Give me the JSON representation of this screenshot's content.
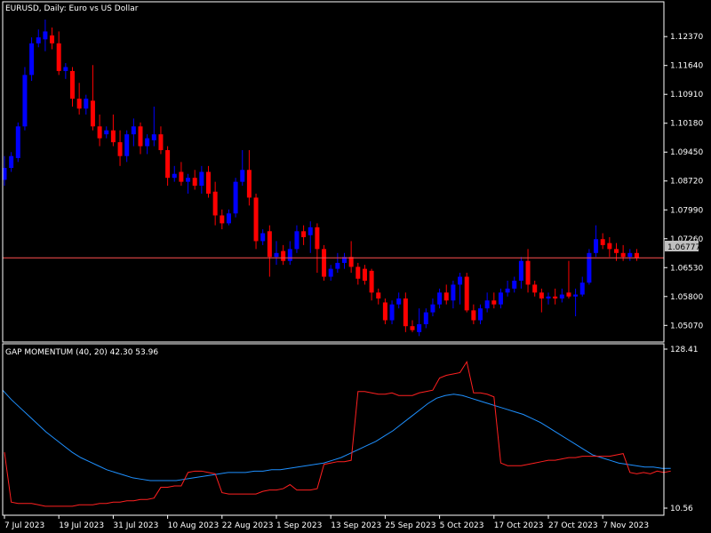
{
  "title": "EURUSD, Daily:  Euro vs US Dollar",
  "price_label": "1.06777",
  "indicator_title": "GAP MOMENTUM (40, 20) 42.30 53.96",
  "colors": {
    "background": "#000000",
    "frame": "#ffffff",
    "bull": "#0000ff",
    "bear": "#ff0000",
    "price_line": "#ff5050",
    "price_label_bg": "#c0c0c0",
    "gap_line": "#ff2020",
    "signal_line": "#1e90ff"
  },
  "chart_data": [
    {
      "type": "candlestick",
      "symbol": "EURUSD",
      "timeframe": "Daily",
      "y_ticks": [
        "1.12370",
        "1.11640",
        "1.10910",
        "1.10180",
        "1.09450",
        "1.08720",
        "1.07990",
        "1.07260",
        "1.06530",
        "1.05800",
        "1.05070"
      ],
      "ylim": [
        1.0465,
        1.1325
      ],
      "current_price": 1.06777,
      "x_labels": [
        "7 Jul 2023",
        "19 Jul 2023",
        "31 Jul 2023",
        "10 Aug 2023",
        "22 Aug 2023",
        "1 Sep 2023",
        "13 Sep 2023",
        "25 Sep 2023",
        "5 Oct 2023",
        "17 Oct 2023",
        "27 Oct 2023",
        "7 Nov 2023"
      ],
      "x_label_index": [
        0,
        8,
        16,
        24,
        32,
        40,
        48,
        56,
        64,
        72,
        80,
        88
      ],
      "candles": [
        {
          "o": 1.0875,
          "h": 1.0935,
          "l": 1.086,
          "c": 1.0905
        },
        {
          "o": 1.0905,
          "h": 1.0945,
          "l": 1.0895,
          "c": 1.0935
        },
        {
          "o": 1.093,
          "h": 1.102,
          "l": 1.092,
          "c": 1.101
        },
        {
          "o": 1.101,
          "h": 1.116,
          "l": 1.1,
          "c": 1.114
        },
        {
          "o": 1.114,
          "h": 1.1235,
          "l": 1.1125,
          "c": 1.122
        },
        {
          "o": 1.122,
          "h": 1.1255,
          "l": 1.121,
          "c": 1.1235
        },
        {
          "o": 1.123,
          "h": 1.128,
          "l": 1.12,
          "c": 1.125
        },
        {
          "o": 1.124,
          "h": 1.126,
          "l": 1.1205,
          "c": 1.122
        },
        {
          "o": 1.122,
          "h": 1.125,
          "l": 1.114,
          "c": 1.115
        },
        {
          "o": 1.115,
          "h": 1.117,
          "l": 1.113,
          "c": 1.116
        },
        {
          "o": 1.115,
          "h": 1.116,
          "l": 1.106,
          "c": 1.108
        },
        {
          "o": 1.108,
          "h": 1.112,
          "l": 1.104,
          "c": 1.1055
        },
        {
          "o": 1.1055,
          "h": 1.109,
          "l": 1.104,
          "c": 1.108
        },
        {
          "o": 1.1075,
          "h": 1.1165,
          "l": 1.1,
          "c": 1.101
        },
        {
          "o": 1.101,
          "h": 1.104,
          "l": 1.096,
          "c": 1.098
        },
        {
          "o": 1.099,
          "h": 1.101,
          "l": 1.098,
          "c": 1.1
        },
        {
          "o": 1.1,
          "h": 1.104,
          "l": 1.096,
          "c": 1.097
        },
        {
          "o": 1.097,
          "h": 1.1,
          "l": 1.091,
          "c": 1.0935
        },
        {
          "o": 1.0935,
          "h": 1.1,
          "l": 1.092,
          "c": 1.099
        },
        {
          "o": 1.099,
          "h": 1.103,
          "l": 1.096,
          "c": 1.101
        },
        {
          "o": 1.101,
          "h": 1.102,
          "l": 1.094,
          "c": 1.096
        },
        {
          "o": 1.096,
          "h": 1.099,
          "l": 1.094,
          "c": 1.098
        },
        {
          "o": 1.0975,
          "h": 1.106,
          "l": 1.096,
          "c": 1.099
        },
        {
          "o": 1.099,
          "h": 1.101,
          "l": 1.094,
          "c": 1.095
        },
        {
          "o": 1.095,
          "h": 1.096,
          "l": 1.086,
          "c": 1.088
        },
        {
          "o": 1.088,
          "h": 1.091,
          "l": 1.087,
          "c": 1.089
        },
        {
          "o": 1.0895,
          "h": 1.092,
          "l": 1.086,
          "c": 1.087
        },
        {
          "o": 1.087,
          "h": 1.089,
          "l": 1.084,
          "c": 1.088
        },
        {
          "o": 1.088,
          "h": 1.09,
          "l": 1.085,
          "c": 1.086
        },
        {
          "o": 1.086,
          "h": 1.091,
          "l": 1.084,
          "c": 1.0895
        },
        {
          "o": 1.0895,
          "h": 1.091,
          "l": 1.083,
          "c": 1.084
        },
        {
          "o": 1.0845,
          "h": 1.087,
          "l": 1.076,
          "c": 1.0785
        },
        {
          "o": 1.0785,
          "h": 1.08,
          "l": 1.075,
          "c": 1.0765
        },
        {
          "o": 1.0765,
          "h": 1.08,
          "l": 1.076,
          "c": 1.079
        },
        {
          "o": 1.079,
          "h": 1.088,
          "l": 1.078,
          "c": 1.087
        },
        {
          "o": 1.087,
          "h": 1.095,
          "l": 1.086,
          "c": 1.09
        },
        {
          "o": 1.09,
          "h": 1.095,
          "l": 1.081,
          "c": 1.083
        },
        {
          "o": 1.083,
          "h": 1.084,
          "l": 1.07,
          "c": 1.072
        },
        {
          "o": 1.072,
          "h": 1.075,
          "l": 1.071,
          "c": 1.074
        },
        {
          "o": 1.0745,
          "h": 1.076,
          "l": 1.063,
          "c": 1.068
        },
        {
          "o": 1.068,
          "h": 1.072,
          "l": 1.066,
          "c": 1.069
        },
        {
          "o": 1.0695,
          "h": 1.071,
          "l": 1.066,
          "c": 1.067
        },
        {
          "o": 1.067,
          "h": 1.072,
          "l": 1.066,
          "c": 1.07
        },
        {
          "o": 1.07,
          "h": 1.076,
          "l": 1.069,
          "c": 1.0745
        },
        {
          "o": 1.0745,
          "h": 1.076,
          "l": 1.071,
          "c": 1.073
        },
        {
          "o": 1.0735,
          "h": 1.077,
          "l": 1.069,
          "c": 1.0755
        },
        {
          "o": 1.0755,
          "h": 1.0765,
          "l": 1.064,
          "c": 1.07
        },
        {
          "o": 1.07,
          "h": 1.071,
          "l": 1.062,
          "c": 1.063
        },
        {
          "o": 1.063,
          "h": 1.066,
          "l": 1.062,
          "c": 1.065
        },
        {
          "o": 1.065,
          "h": 1.069,
          "l": 1.064,
          "c": 1.0665
        },
        {
          "o": 1.0665,
          "h": 1.069,
          "l": 1.065,
          "c": 1.068
        },
        {
          "o": 1.068,
          "h": 1.072,
          "l": 1.064,
          "c": 1.0655
        },
        {
          "o": 1.0655,
          "h": 1.0665,
          "l": 1.061,
          "c": 1.0625
        },
        {
          "o": 1.065,
          "h": 1.066,
          "l": 1.061,
          "c": 1.062
        },
        {
          "o": 1.0645,
          "h": 1.065,
          "l": 1.057,
          "c": 1.059
        },
        {
          "o": 1.059,
          "h": 1.06,
          "l": 1.056,
          "c": 1.0575
        },
        {
          "o": 1.0565,
          "h": 1.0575,
          "l": 1.051,
          "c": 1.052
        },
        {
          "o": 1.052,
          "h": 1.057,
          "l": 1.051,
          "c": 1.056
        },
        {
          "o": 1.056,
          "h": 1.059,
          "l": 1.055,
          "c": 1.0575
        },
        {
          "o": 1.0575,
          "h": 1.059,
          "l": 1.049,
          "c": 1.0505
        },
        {
          "o": 1.0505,
          "h": 1.052,
          "l": 1.049,
          "c": 1.0495
        },
        {
          "o": 1.049,
          "h": 1.055,
          "l": 1.048,
          "c": 1.051
        },
        {
          "o": 1.051,
          "h": 1.055,
          "l": 1.05,
          "c": 1.054
        },
        {
          "o": 1.054,
          "h": 1.0575,
          "l": 1.053,
          "c": 1.056
        },
        {
          "o": 1.056,
          "h": 1.06,
          "l": 1.055,
          "c": 1.059
        },
        {
          "o": 1.059,
          "h": 1.061,
          "l": 1.056,
          "c": 1.057
        },
        {
          "o": 1.057,
          "h": 1.062,
          "l": 1.055,
          "c": 1.061
        },
        {
          "o": 1.061,
          "h": 1.064,
          "l": 1.056,
          "c": 1.063
        },
        {
          "o": 1.063,
          "h": 1.064,
          "l": 1.054,
          "c": 1.0545
        },
        {
          "o": 1.0545,
          "h": 1.056,
          "l": 1.051,
          "c": 1.052
        },
        {
          "o": 1.052,
          "h": 1.056,
          "l": 1.051,
          "c": 1.055
        },
        {
          "o": 1.055,
          "h": 1.059,
          "l": 1.054,
          "c": 1.057
        },
        {
          "o": 1.057,
          "h": 1.059,
          "l": 1.055,
          "c": 1.056
        },
        {
          "o": 1.056,
          "h": 1.06,
          "l": 1.055,
          "c": 1.059
        },
        {
          "o": 1.059,
          "h": 1.062,
          "l": 1.058,
          "c": 1.06
        },
        {
          "o": 1.06,
          "h": 1.063,
          "l": 1.059,
          "c": 1.062
        },
        {
          "o": 1.062,
          "h": 1.068,
          "l": 1.06,
          "c": 1.067
        },
        {
          "o": 1.067,
          "h": 1.07,
          "l": 1.059,
          "c": 1.061
        },
        {
          "o": 1.061,
          "h": 1.062,
          "l": 1.058,
          "c": 1.059
        },
        {
          "o": 1.059,
          "h": 1.06,
          "l": 1.054,
          "c": 1.0575
        },
        {
          "o": 1.0575,
          "h": 1.059,
          "l": 1.056,
          "c": 1.058
        },
        {
          "o": 1.058,
          "h": 1.06,
          "l": 1.056,
          "c": 1.0575
        },
        {
          "o": 1.0575,
          "h": 1.06,
          "l": 1.0565,
          "c": 1.0585
        },
        {
          "o": 1.059,
          "h": 1.067,
          "l": 1.0575,
          "c": 1.058
        },
        {
          "o": 1.058,
          "h": 1.06,
          "l": 1.053,
          "c": 1.0585
        },
        {
          "o": 1.0585,
          "h": 1.063,
          "l": 1.058,
          "c": 1.0615
        },
        {
          "o": 1.0615,
          "h": 1.07,
          "l": 1.061,
          "c": 1.069
        },
        {
          "o": 1.069,
          "h": 1.076,
          "l": 1.068,
          "c": 1.0725
        },
        {
          "o": 1.0725,
          "h": 1.074,
          "l": 1.07,
          "c": 1.071
        },
        {
          "o": 1.0715,
          "h": 1.073,
          "l": 1.068,
          "c": 1.07
        },
        {
          "o": 1.07,
          "h": 1.0715,
          "l": 1.067,
          "c": 1.069
        },
        {
          "o": 1.069,
          "h": 1.071,
          "l": 1.067,
          "c": 1.068
        },
        {
          "o": 1.068,
          "h": 1.07,
          "l": 1.067,
          "c": 1.069
        },
        {
          "o": 1.069,
          "h": 1.07,
          "l": 1.067,
          "c": 1.0678
        }
      ]
    },
    {
      "type": "line",
      "title": "GAP MOMENTUM (40, 20) 42.30 53.96",
      "y_ticks": [
        "128.41",
        "10.56"
      ],
      "ylim": [
        10.56,
        128.41
      ],
      "series": [
        {
          "values": [
            52,
            15,
            14,
            14,
            14,
            13,
            12,
            12,
            12,
            12,
            12,
            13,
            13,
            13,
            14,
            14,
            15,
            15,
            16,
            16,
            17,
            17,
            18,
            26,
            26,
            27,
            27,
            37,
            38,
            38,
            37,
            36,
            22,
            21,
            21,
            21,
            21,
            21,
            23,
            24,
            24,
            25,
            28,
            24,
            24,
            24,
            25,
            43,
            44,
            45,
            45,
            46,
            97,
            97,
            96,
            95,
            95,
            96,
            94,
            94,
            94,
            96,
            97,
            98,
            107,
            109,
            110,
            111,
            119,
            96,
            96,
            95,
            93,
            44,
            42,
            42,
            42,
            43,
            44,
            45,
            46,
            46,
            47,
            48,
            48,
            49,
            49,
            49,
            49,
            49,
            50,
            51,
            37,
            36,
            37,
            36,
            38,
            37,
            38
          ]
        },
        {
          "values": [
            98,
            91,
            85,
            79,
            73,
            67,
            62,
            57,
            52,
            48,
            45,
            42,
            39,
            37,
            35,
            33,
            32,
            31,
            31,
            31,
            31,
            32,
            33,
            34,
            35,
            36,
            37,
            37,
            37,
            38,
            38,
            39,
            39,
            40,
            41,
            42,
            43,
            44,
            46,
            48,
            51,
            54,
            57,
            60,
            64,
            68,
            73,
            78,
            83,
            88,
            92,
            94,
            95,
            94,
            92,
            90,
            88,
            86,
            84,
            82,
            80,
            77,
            74,
            70,
            66,
            62,
            58,
            54,
            50,
            48,
            46,
            44,
            43,
            42,
            41,
            41,
            40,
            40
          ]
        }
      ]
    }
  ]
}
